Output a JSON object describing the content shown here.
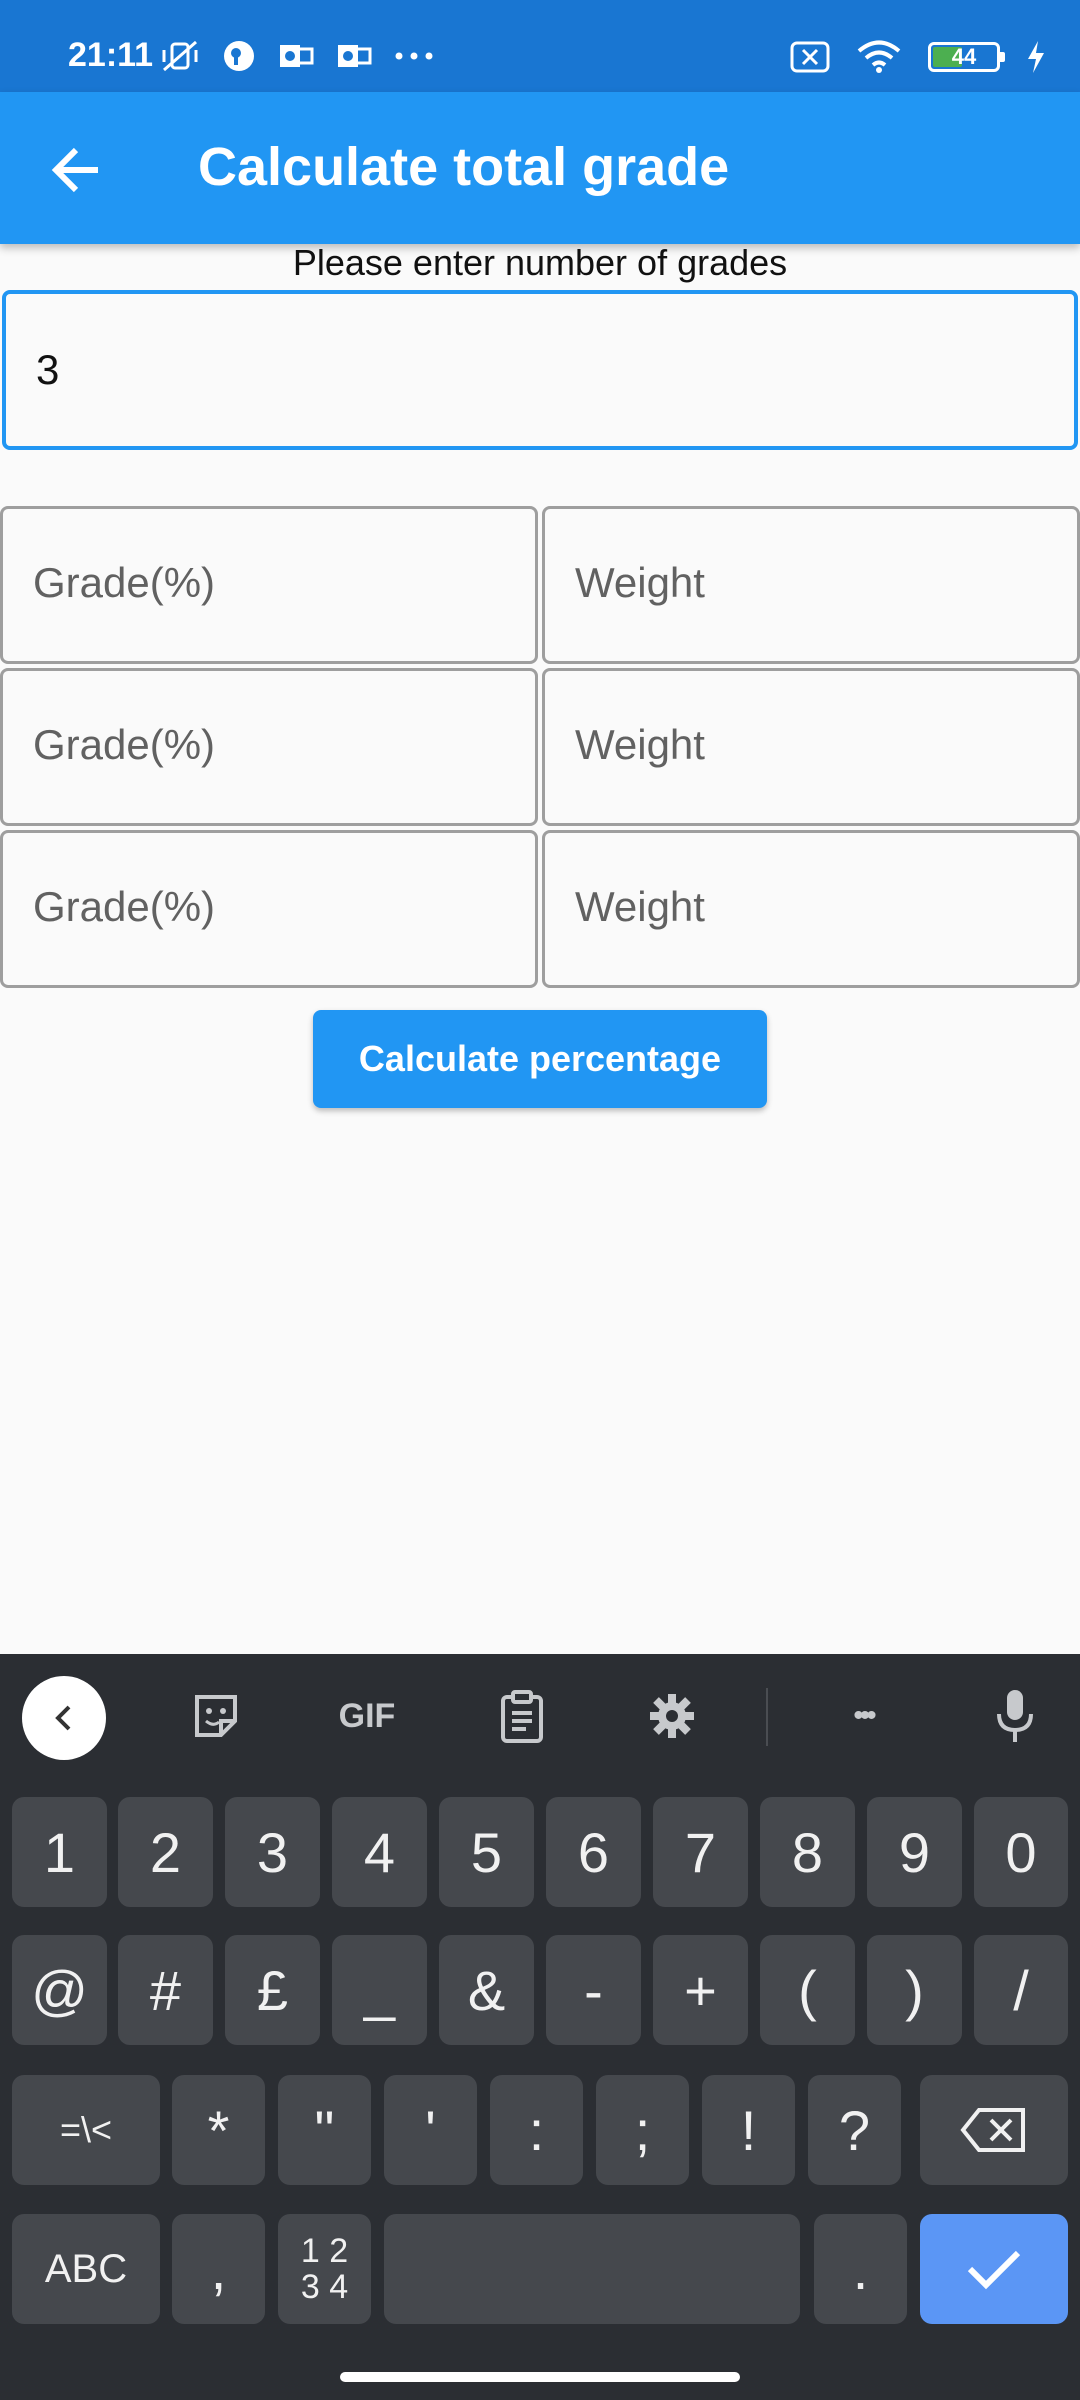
{
  "status_bar": {
    "time": "21:11",
    "battery": "44",
    "icons": [
      "vibrate-off-icon",
      "vpn-icon",
      "outlook-icon",
      "outlook-icon",
      "more-icon",
      "no-sim-icon",
      "wifi-icon",
      "battery-icon",
      "charging-icon"
    ]
  },
  "app_bar": {
    "title": "Calculate total grade",
    "back_icon": "arrow-left-icon"
  },
  "form": {
    "prompt": "Please enter number of grades",
    "count_value": "3",
    "rows": [
      {
        "grade_placeholder": "Grade(%)",
        "weight_placeholder": "Weight"
      },
      {
        "grade_placeholder": "Grade(%)",
        "weight_placeholder": "Weight"
      },
      {
        "grade_placeholder": "Grade(%)",
        "weight_placeholder": "Weight"
      }
    ],
    "calculate_label": "Calculate percentage"
  },
  "keyboard": {
    "toolbar": {
      "gif_label": "GIF",
      "more_label": "•••"
    },
    "row1": [
      "1",
      "2",
      "3",
      "4",
      "5",
      "6",
      "7",
      "8",
      "9",
      "0"
    ],
    "row2": [
      "@",
      "#",
      "£",
      "_",
      "&",
      "-",
      "+",
      "(",
      ")",
      "/"
    ],
    "row3": {
      "symbols_key": "=\\<",
      "keys": [
        "*",
        "\"",
        "'",
        ":",
        ";",
        "!",
        "?"
      ]
    },
    "row4": {
      "abc_key": "ABC",
      "comma": ",",
      "numpad_top": "1 2",
      "numpad_bottom": "3 4",
      "period": "."
    }
  }
}
